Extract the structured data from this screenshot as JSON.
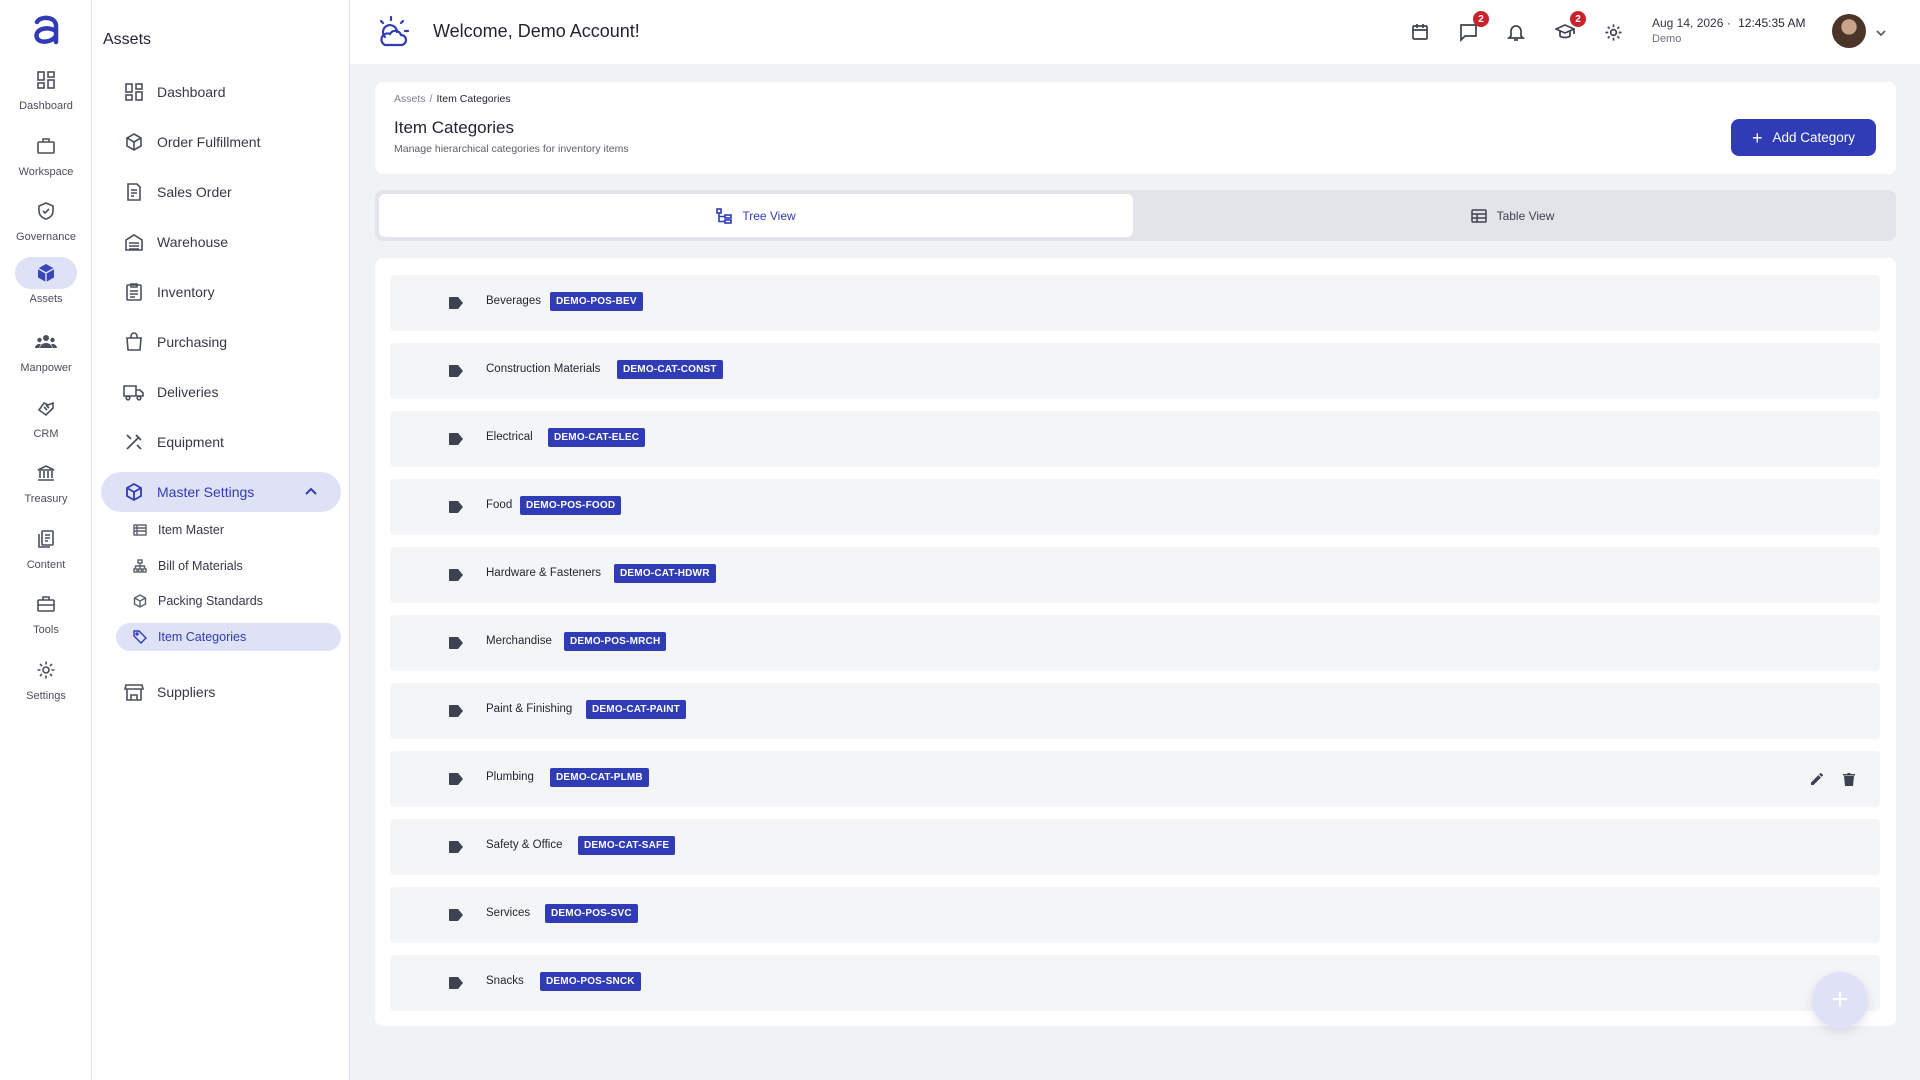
{
  "rail": {
    "items": [
      {
        "label": "Dashboard",
        "icon": "grid-icon"
      },
      {
        "label": "Workspace",
        "icon": "briefcase-icon"
      },
      {
        "label": "Governance",
        "icon": "shield-check-icon"
      },
      {
        "label": "Assets",
        "icon": "cube-icon",
        "active": true
      },
      {
        "label": "Manpower",
        "icon": "people-icon"
      },
      {
        "label": "CRM",
        "icon": "handshake-icon"
      },
      {
        "label": "Treasury",
        "icon": "bank-icon"
      },
      {
        "label": "Content",
        "icon": "documents-icon"
      },
      {
        "label": "Tools",
        "icon": "toolbox-icon"
      },
      {
        "label": "Settings",
        "icon": "gear-icon"
      }
    ]
  },
  "sidebar": {
    "title": "Assets",
    "items": [
      {
        "label": "Dashboard",
        "icon": "grid-icon"
      },
      {
        "label": "Order Fulfillment",
        "icon": "box-icon"
      },
      {
        "label": "Sales Order",
        "icon": "receipt-icon"
      },
      {
        "label": "Warehouse",
        "icon": "warehouse-icon"
      },
      {
        "label": "Inventory",
        "icon": "clipboard-icon"
      },
      {
        "label": "Purchasing",
        "icon": "shopping-bag-icon"
      },
      {
        "label": "Deliveries",
        "icon": "truck-icon"
      },
      {
        "label": "Equipment",
        "icon": "tools-icon"
      }
    ],
    "group": {
      "label": "Master Settings",
      "icon": "cube-icon",
      "expanded": true
    },
    "sub_items": [
      {
        "label": "Item Master",
        "icon": "list-icon"
      },
      {
        "label": "Bill of Materials",
        "icon": "hierarchy-icon"
      },
      {
        "label": "Packing Standards",
        "icon": "package-icon"
      },
      {
        "label": "Item Categories",
        "icon": "tag-icon",
        "active": true
      }
    ],
    "after": {
      "label": "Suppliers",
      "icon": "store-icon"
    }
  },
  "header": {
    "welcome": "Welcome, Demo Account!",
    "chat_badge": "2",
    "learning_badge": "2",
    "date": "Aug 14, 2026",
    "time": "12:45:35 AM",
    "date_separator": "·",
    "org": "Demo"
  },
  "page": {
    "breadcrumb_root": "Assets",
    "breadcrumb_separator": "/",
    "breadcrumb_current": "Item Categories",
    "title": "Item Categories",
    "subtitle": "Manage hierarchical categories for inventory items",
    "add_button": "Add Category"
  },
  "view_toggle": {
    "tree": "Tree View",
    "table": "Table View",
    "selected": "tree"
  },
  "categories": [
    {
      "name": "Beverages",
      "code": "DEMO-POS-BEV"
    },
    {
      "name": "Construction Materials",
      "code": "DEMO-CAT-CONST"
    },
    {
      "name": "Electrical",
      "code": "DEMO-CAT-ELEC"
    },
    {
      "name": "Food",
      "code": "DEMO-POS-FOOD"
    },
    {
      "name": "Hardware & Fasteners",
      "code": "DEMO-CAT-HDWR"
    },
    {
      "name": "Merchandise",
      "code": "DEMO-POS-MRCH"
    },
    {
      "name": "Paint & Finishing",
      "code": "DEMO-CAT-PAINT"
    },
    {
      "name": "Plumbing",
      "code": "DEMO-CAT-PLMB",
      "hovered": true
    },
    {
      "name": "Safety & Office",
      "code": "DEMO-CAT-SAFE"
    },
    {
      "name": "Services",
      "code": "DEMO-POS-SVC"
    },
    {
      "name": "Snacks",
      "code": "DEMO-POS-SNCK"
    }
  ],
  "fab": "+",
  "colors": {
    "primary": "#2f3cb5",
    "active_bg": "#dfe2f6",
    "badge": "#c8232c",
    "page_bg": "#f1f2f5",
    "row_bg": "#f4f5f7"
  }
}
